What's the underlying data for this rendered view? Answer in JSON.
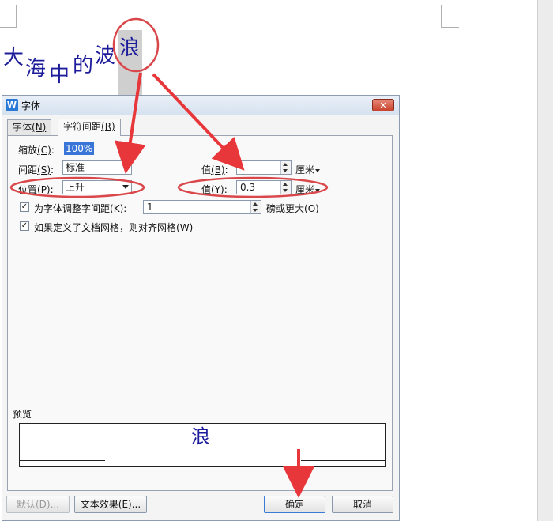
{
  "document": {
    "chars": [
      "大",
      "海",
      "中",
      "的",
      "波",
      "浪"
    ]
  },
  "dialog": {
    "title": "字体",
    "app_icon_glyph": "W",
    "close_glyph": "✕",
    "tabs": [
      {
        "label": "字体",
        "hotkey": "(N)"
      },
      {
        "label": "字符间距",
        "hotkey": "(R)"
      }
    ],
    "scale": {
      "label": "缩放",
      "hotkey": "(C)",
      "value": "100%"
    },
    "spacing": {
      "label": "间距",
      "hotkey": "(S)",
      "value": "标准",
      "by_label": "值",
      "by_hotkey": "(B)",
      "by_value": "",
      "unit": "厘米"
    },
    "position": {
      "label": "位置",
      "hotkey": "(P)",
      "value": "上升",
      "by_label": "值",
      "by_hotkey": "(Y)",
      "by_value": "0.3",
      "unit": "厘米"
    },
    "kerning": {
      "label": "为字体调整字间距",
      "hotkey": "(K)",
      "value": "1",
      "suffix": "磅或更大",
      "suffix_hotkey": "(O)",
      "checked": true
    },
    "grid": {
      "label": "如果定义了文档网格，则对齐网格",
      "hotkey": "(W)",
      "checked": true
    },
    "preview": {
      "label": "预览",
      "sample": "浪"
    },
    "buttons": {
      "default": "默认(D)...",
      "text_effect": "文本效果(E)...",
      "ok": "确定",
      "cancel": "取消"
    }
  },
  "annotation_colors": {
    "circle": "#d9474a",
    "arrow": "#e8373a"
  }
}
